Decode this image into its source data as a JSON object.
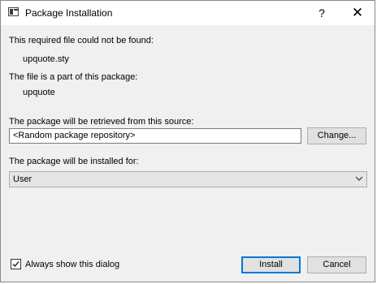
{
  "window": {
    "title": "Package Installation",
    "help_glyph": "?",
    "close_glyph": "✕",
    "icon": "window-icon"
  },
  "body": {
    "not_found_label": "This required file could not be found:",
    "file_name": "upquote.sty",
    "part_of_label": "The file is a part of this package:",
    "package_name": "upquote",
    "source_label": "The package will be retrieved from this source:",
    "source_value": "<Random package repository>",
    "change_button": "Change...",
    "installed_for_label": "The package will be installed for:",
    "installed_for_value": "User"
  },
  "footer": {
    "always_show_label": "Always show this dialog",
    "always_show_checked": true,
    "install_button": "Install",
    "cancel_button": "Cancel"
  },
  "colors": {
    "dialog_bg": "#f0f0f0",
    "titlebar_bg": "#ffffff",
    "default_button_border": "#0078d7"
  }
}
